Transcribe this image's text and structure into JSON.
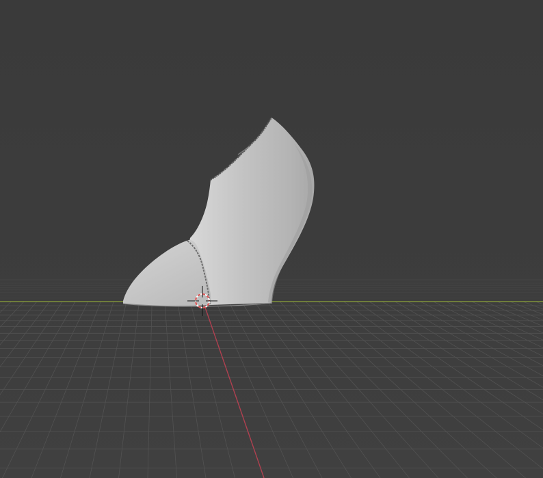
{
  "viewport": {
    "background_color": "#3d3d3d",
    "grid_line_color": "#525252",
    "x_axis_color": "#8ba23a",
    "y_axis_color": "#b04050",
    "mesh_color": "#c4c4c4",
    "mesh_shadow_color": "#9e9e9e",
    "cursor_color_primary": "#e05050",
    "cursor_color_secondary": "#ffffff"
  },
  "scene": {
    "object": "shoe-heel-mesh",
    "cursor": "3d-cursor-icon"
  }
}
